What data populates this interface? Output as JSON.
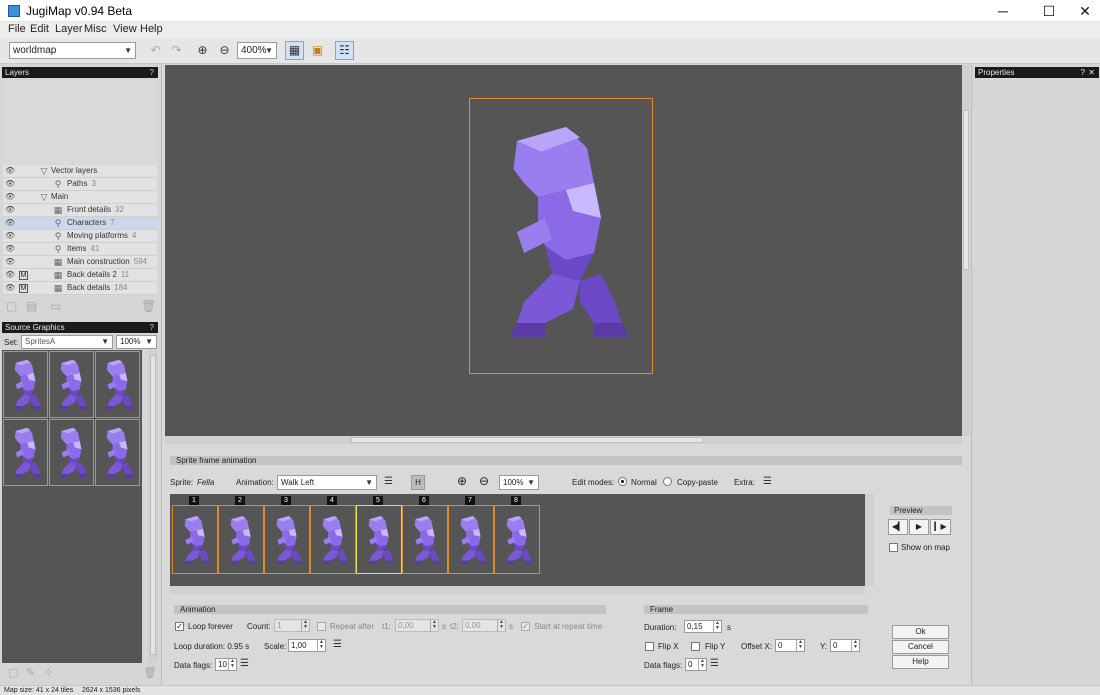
{
  "window": {
    "title": "JugiMap v0.94 Beta",
    "minimize": "─",
    "maximize": "☐",
    "close": "✕"
  },
  "menu": [
    "File",
    "Edit",
    "Layer",
    "Misc",
    "View",
    "Help"
  ],
  "toolbar": {
    "map_select": "worldmap",
    "zoom": "400%"
  },
  "layers_panel": {
    "title": "Layers",
    "help": "?",
    "rows": [
      {
        "name": "Vector layers",
        "count": "",
        "type": "group"
      },
      {
        "name": "Paths",
        "count": "3",
        "type": "vector"
      },
      {
        "name": "Main",
        "count": "",
        "type": "group"
      },
      {
        "name": "Front details",
        "count": "32",
        "type": "grid"
      },
      {
        "name": "Characters",
        "count": "7",
        "type": "vector",
        "selected": true
      },
      {
        "name": "Moving platforms",
        "count": "4",
        "type": "vector"
      },
      {
        "name": "Items",
        "count": "41",
        "type": "vector"
      },
      {
        "name": "Main construction",
        "count": "594",
        "type": "grid"
      },
      {
        "name": "Back details 2",
        "count": "11",
        "type": "grid",
        "mark": "M"
      },
      {
        "name": "Back details",
        "count": "184",
        "type": "grid",
        "mark": "M"
      }
    ]
  },
  "source_graphics": {
    "title": "Source Graphics",
    "help": "?",
    "set_label": "Set:",
    "set_value": "SpritesA",
    "zoom": "100%"
  },
  "properties_panel": {
    "title": "Properties",
    "help": "?",
    "close": "✕"
  },
  "anim_panel": {
    "header": "Sprite frame animation",
    "sprite_label": "Sprite:",
    "sprite_name": "Fella",
    "animation_label": "Animation:",
    "animation_value": "Walk Left",
    "h_button": "H",
    "zoom": "100%",
    "edit_modes_label": "Edit modes:",
    "mode_normal": "Normal",
    "mode_copy": "Copy-paste",
    "extra_label": "Extra:",
    "frame_numbers": [
      "1",
      "2",
      "3",
      "4",
      "5",
      "6",
      "7",
      "8"
    ],
    "current_frame": 5
  },
  "preview": {
    "title": "Preview",
    "show_on_map": "Show on map"
  },
  "animation": {
    "title": "Animation",
    "loop_forever": "Loop forever",
    "count_label": "Count:",
    "count_value": "1",
    "repeat_after": "Repeat after",
    "t1_label": "t1:",
    "t1_value": "0,00",
    "t1_unit": "s",
    "t2_label": "t2:",
    "t2_value": "0,00",
    "t2_unit": "s",
    "start_at_repeat": "Start at repeat time",
    "loop_duration": "Loop duration: 0.95 s",
    "scale_label": "Scale:",
    "scale_value": "1,00",
    "data_flags_label": "Data flags:",
    "data_flags_value": "10"
  },
  "frame": {
    "title": "Frame",
    "duration_label": "Duration:",
    "duration_value": "0,15",
    "duration_unit": "s",
    "flip_x": "Flip X",
    "flip_y": "Flip Y",
    "offset_x_label": "Offset X:",
    "offset_x_value": "0",
    "y_label": "Y:",
    "y_value": "0",
    "data_flags_label": "Data flags:",
    "data_flags_value": "0"
  },
  "buttons": {
    "ok": "Ok",
    "cancel": "Cancel",
    "help": "Help"
  },
  "statusbar": {
    "map_size": "Map size: 41 x 24 tiles",
    "pixels": "2624 x 1536 pixels"
  },
  "colors": {
    "canvas": "#555555",
    "sprite_light": "#9a7ef0",
    "sprite_dark": "#5b3aa6",
    "frame_border": "#e08a2a",
    "current_frame": "#e6e040"
  }
}
